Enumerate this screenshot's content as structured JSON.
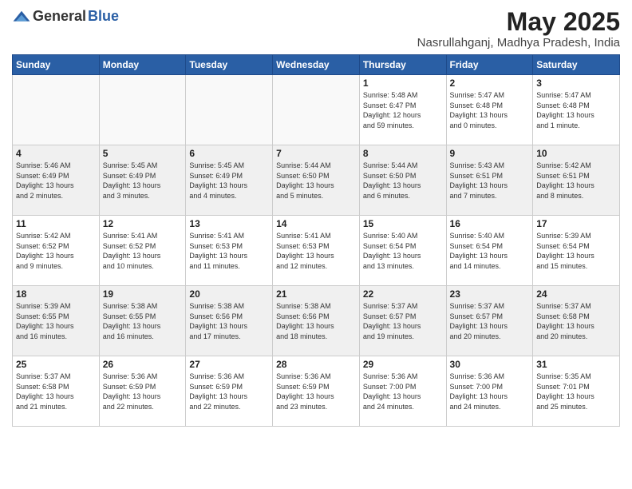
{
  "logo": {
    "general": "General",
    "blue": "Blue"
  },
  "title": "May 2025",
  "location": "Nasrullahganj, Madhya Pradesh, India",
  "headers": [
    "Sunday",
    "Monday",
    "Tuesday",
    "Wednesday",
    "Thursday",
    "Friday",
    "Saturday"
  ],
  "weeks": [
    [
      {
        "day": "",
        "info": ""
      },
      {
        "day": "",
        "info": ""
      },
      {
        "day": "",
        "info": ""
      },
      {
        "day": "",
        "info": ""
      },
      {
        "day": "1",
        "info": "Sunrise: 5:48 AM\nSunset: 6:47 PM\nDaylight: 12 hours\nand 59 minutes."
      },
      {
        "day": "2",
        "info": "Sunrise: 5:47 AM\nSunset: 6:48 PM\nDaylight: 13 hours\nand 0 minutes."
      },
      {
        "day": "3",
        "info": "Sunrise: 5:47 AM\nSunset: 6:48 PM\nDaylight: 13 hours\nand 1 minute."
      }
    ],
    [
      {
        "day": "4",
        "info": "Sunrise: 5:46 AM\nSunset: 6:49 PM\nDaylight: 13 hours\nand 2 minutes."
      },
      {
        "day": "5",
        "info": "Sunrise: 5:45 AM\nSunset: 6:49 PM\nDaylight: 13 hours\nand 3 minutes."
      },
      {
        "day": "6",
        "info": "Sunrise: 5:45 AM\nSunset: 6:49 PM\nDaylight: 13 hours\nand 4 minutes."
      },
      {
        "day": "7",
        "info": "Sunrise: 5:44 AM\nSunset: 6:50 PM\nDaylight: 13 hours\nand 5 minutes."
      },
      {
        "day": "8",
        "info": "Sunrise: 5:44 AM\nSunset: 6:50 PM\nDaylight: 13 hours\nand 6 minutes."
      },
      {
        "day": "9",
        "info": "Sunrise: 5:43 AM\nSunset: 6:51 PM\nDaylight: 13 hours\nand 7 minutes."
      },
      {
        "day": "10",
        "info": "Sunrise: 5:42 AM\nSunset: 6:51 PM\nDaylight: 13 hours\nand 8 minutes."
      }
    ],
    [
      {
        "day": "11",
        "info": "Sunrise: 5:42 AM\nSunset: 6:52 PM\nDaylight: 13 hours\nand 9 minutes."
      },
      {
        "day": "12",
        "info": "Sunrise: 5:41 AM\nSunset: 6:52 PM\nDaylight: 13 hours\nand 10 minutes."
      },
      {
        "day": "13",
        "info": "Sunrise: 5:41 AM\nSunset: 6:53 PM\nDaylight: 13 hours\nand 11 minutes."
      },
      {
        "day": "14",
        "info": "Sunrise: 5:41 AM\nSunset: 6:53 PM\nDaylight: 13 hours\nand 12 minutes."
      },
      {
        "day": "15",
        "info": "Sunrise: 5:40 AM\nSunset: 6:54 PM\nDaylight: 13 hours\nand 13 minutes."
      },
      {
        "day": "16",
        "info": "Sunrise: 5:40 AM\nSunset: 6:54 PM\nDaylight: 13 hours\nand 14 minutes."
      },
      {
        "day": "17",
        "info": "Sunrise: 5:39 AM\nSunset: 6:54 PM\nDaylight: 13 hours\nand 15 minutes."
      }
    ],
    [
      {
        "day": "18",
        "info": "Sunrise: 5:39 AM\nSunset: 6:55 PM\nDaylight: 13 hours\nand 16 minutes."
      },
      {
        "day": "19",
        "info": "Sunrise: 5:38 AM\nSunset: 6:55 PM\nDaylight: 13 hours\nand 16 minutes."
      },
      {
        "day": "20",
        "info": "Sunrise: 5:38 AM\nSunset: 6:56 PM\nDaylight: 13 hours\nand 17 minutes."
      },
      {
        "day": "21",
        "info": "Sunrise: 5:38 AM\nSunset: 6:56 PM\nDaylight: 13 hours\nand 18 minutes."
      },
      {
        "day": "22",
        "info": "Sunrise: 5:37 AM\nSunset: 6:57 PM\nDaylight: 13 hours\nand 19 minutes."
      },
      {
        "day": "23",
        "info": "Sunrise: 5:37 AM\nSunset: 6:57 PM\nDaylight: 13 hours\nand 20 minutes."
      },
      {
        "day": "24",
        "info": "Sunrise: 5:37 AM\nSunset: 6:58 PM\nDaylight: 13 hours\nand 20 minutes."
      }
    ],
    [
      {
        "day": "25",
        "info": "Sunrise: 5:37 AM\nSunset: 6:58 PM\nDaylight: 13 hours\nand 21 minutes."
      },
      {
        "day": "26",
        "info": "Sunrise: 5:36 AM\nSunset: 6:59 PM\nDaylight: 13 hours\nand 22 minutes."
      },
      {
        "day": "27",
        "info": "Sunrise: 5:36 AM\nSunset: 6:59 PM\nDaylight: 13 hours\nand 22 minutes."
      },
      {
        "day": "28",
        "info": "Sunrise: 5:36 AM\nSunset: 6:59 PM\nDaylight: 13 hours\nand 23 minutes."
      },
      {
        "day": "29",
        "info": "Sunrise: 5:36 AM\nSunset: 7:00 PM\nDaylight: 13 hours\nand 24 minutes."
      },
      {
        "day": "30",
        "info": "Sunrise: 5:36 AM\nSunset: 7:00 PM\nDaylight: 13 hours\nand 24 minutes."
      },
      {
        "day": "31",
        "info": "Sunrise: 5:35 AM\nSunset: 7:01 PM\nDaylight: 13 hours\nand 25 minutes."
      }
    ]
  ]
}
